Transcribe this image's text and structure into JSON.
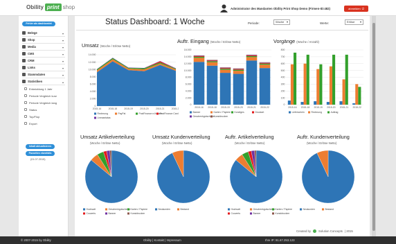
{
  "app": {
    "logo_part1": "Obility",
    "logo_part2": "print",
    "logo_part3": "shop"
  },
  "header": {
    "user_text": "Administrator des Mandanten Obility Print Shop Demo (Firmen-ID:482)",
    "logout_label": "abmelden"
  },
  "sidebar": {
    "new_dashboard": "Fehler als dashbordet",
    "items": [
      {
        "label": "Belege",
        "icon": "document-icon"
      },
      {
        "label": "Shop",
        "icon": "shop-icon"
      },
      {
        "label": "Media",
        "icon": "media-icon"
      },
      {
        "label": "CMS",
        "icon": "cms-icon"
      },
      {
        "label": "CRM",
        "icon": "crm-icon"
      },
      {
        "label": "Links",
        "icon": "link-icon"
      },
      {
        "label": "Stammdaten",
        "icon": "database-icon"
      },
      {
        "label": "Statistiken",
        "icon": "chart-icon"
      }
    ],
    "subitems": [
      "Entwicklung 1 Jahr",
      "Periode Vergleich kurz",
      "Periode Vergleich lang",
      "Status",
      "Top/Flop",
      "Export"
    ],
    "update_button": "Inhalt aktualisieren",
    "fav_button": "Favoriten ebenfalls",
    "date_text": "(01.07.2015)"
  },
  "main": {
    "title": "Status Dashboard: 1 Woche",
    "periode_label": "Periode:",
    "periode_value": "Woche",
    "werte_label": "Werte:",
    "werte_value": "Erlöse",
    "created_by": "Created by",
    "created_company": "Solution Concepts",
    "created_year": "| 2015"
  },
  "footer": {
    "copyright": "© 2007-2015 by Obility",
    "links": "Obility | Kontakt | Impressum",
    "ip": "Ihre IP: 91.67.253.123"
  },
  "chart_data": [
    {
      "type": "area",
      "title": "Umsatz",
      "subtitle": "(Woche / Erlöse Netto)",
      "x": [
        "2015-16",
        "2015-18",
        "2015-19",
        "2015-20",
        "2015-21",
        "2015-22"
      ],
      "ylim": [
        0,
        14000
      ],
      "yticks": [
        "0",
        "2.000",
        "4.000",
        "6.000",
        "8.000",
        "10.000",
        "12.000",
        "14.000"
      ],
      "series": [
        {
          "name": "Rechnung",
          "color": "#2e75b6",
          "values": [
            9200,
            12200,
            9800,
            9500,
            11200,
            9600
          ]
        },
        {
          "name": "PayPal",
          "color": "#ed7d31",
          "values": [
            500,
            600,
            400,
            500,
            400,
            400
          ]
        },
        {
          "name": "PostFinance e-finance",
          "color": "#33a02c",
          "values": [
            300,
            300,
            200,
            300,
            300,
            200
          ]
        },
        {
          "name": "PostFinance Card",
          "color": "#e31a1c",
          "values": [
            0,
            0,
            0,
            0,
            300,
            0
          ]
        },
        {
          "name": "Lineaseiatas",
          "color": "#7030a0",
          "values": [
            100,
            100,
            100,
            100,
            100,
            100
          ]
        }
      ],
      "legend": "bottom"
    },
    {
      "type": "bar",
      "title": "Auftr. Eingang",
      "subtitle": "(Woche / Erlöse Netto)",
      "categories": [
        "2015-16",
        "2015-18",
        "2015-19",
        "2015-20",
        "2015-21",
        "2015-22"
      ],
      "ylim": [
        0,
        16000
      ],
      "yticks": [
        "0",
        "2.000",
        "4.000",
        "6.000",
        "8.000",
        "10.000",
        "12.000",
        "14.000",
        "16.000"
      ],
      "series": [
        {
          "name": "Banner",
          "color": "#2e75b6",
          "values": [
            12500,
            11400,
            9300,
            9000,
            12900,
            10700
          ]
        },
        {
          "name": "Karten / Papiere",
          "color": "#ed7d31",
          "values": [
            1200,
            1000,
            900,
            900,
            1000,
            1000
          ]
        },
        {
          "name": "Kondiges",
          "color": "#33a02c",
          "values": [
            300,
            300,
            300,
            300,
            300,
            300
          ]
        },
        {
          "name": "Druckart",
          "color": "#e31a1c",
          "values": [
            200,
            200,
            200,
            200,
            200,
            200
          ]
        },
        {
          "name": "Geschenkgutscheine",
          "color": "#7030a0",
          "values": [
            100,
            100,
            100,
            100,
            100,
            100
          ]
        },
        {
          "name": "Kunstdrucken",
          "color": "#8c564b",
          "values": [
            100,
            100,
            100,
            100,
            100,
            100
          ]
        }
      ],
      "legend": "bottom"
    },
    {
      "type": "bar",
      "title": "Vorgänge",
      "subtitle": "(Woche / Anzahl)",
      "categories": [
        "2015-16",
        "2015-18",
        "2015-19",
        "2015-20",
        "2015-21",
        "2015-22"
      ],
      "ylim": [
        0,
        800
      ],
      "series": [
        {
          "name": "Lieferschein",
          "color": "#2e75b6",
          "values": [
            60,
            40,
            50,
            40,
            50,
            20
          ]
        },
        {
          "name": "Rechnung",
          "color": "#ed7d31",
          "values": [
            590,
            600,
            520,
            560,
            370,
            300
          ]
        },
        {
          "name": "Auftrag",
          "color": "#33a02c",
          "values": [
            760,
            730,
            590,
            730,
            730,
            260
          ]
        }
      ],
      "legend": "bottom"
    },
    {
      "type": "pie",
      "title": "Umsatz Artikelverteilung",
      "subtitle": "(Woche / Erlöse Netto)",
      "slices": [
        {
          "name": "Hochsatt",
          "color": "#2e75b6",
          "value": 86
        },
        {
          "name": "Geschenkgutscheine",
          "color": "#ed7d31",
          "value": 5
        },
        {
          "name": "Karten / Papiere",
          "color": "#33a02c",
          "value": 4
        },
        {
          "name": "Couverts",
          "color": "#e31a1c",
          "value": 2
        },
        {
          "name": "Banner",
          "color": "#7030a0",
          "value": 2
        },
        {
          "name": "Kunstdrucken",
          "color": "#8c564b",
          "value": 1
        }
      ]
    },
    {
      "type": "pie",
      "title": "Umsatz Kundenverteilung",
      "subtitle": "(Woche / Erlöse Netto)",
      "slices": [
        {
          "name": "Neukunden",
          "color": "#2e75b6",
          "value": 93
        },
        {
          "name": "Bestand",
          "color": "#ed7d31",
          "value": 7
        }
      ]
    },
    {
      "type": "pie",
      "title": "Auftr. Artikelverteilung",
      "subtitle": "(Woche / Erlöse Netto)",
      "slices": [
        {
          "name": "Hochsatt",
          "color": "#2e75b6",
          "value": 86
        },
        {
          "name": "Geschenkgutscheine",
          "color": "#ed7d31",
          "value": 5
        },
        {
          "name": "Karten / Papiere",
          "color": "#33a02c",
          "value": 4
        },
        {
          "name": "Couverts",
          "color": "#e31a1c",
          "value": 2
        },
        {
          "name": "Banner",
          "color": "#7030a0",
          "value": 2
        },
        {
          "name": "Kunstdrucken",
          "color": "#8c564b",
          "value": 1
        }
      ]
    },
    {
      "type": "pie",
      "title": "Auftr. Kundenverteilung",
      "subtitle": "(Woche / Erlöse Netto)",
      "slices": [
        {
          "name": "Neukunden",
          "color": "#2e75b6",
          "value": 93
        },
        {
          "name": "Bestand",
          "color": "#ed7d31",
          "value": 7
        }
      ]
    }
  ]
}
